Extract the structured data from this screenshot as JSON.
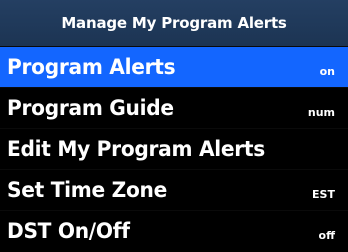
{
  "header": {
    "title": "Manage My Program Alerts"
  },
  "menu": {
    "items": [
      {
        "label": "Program Alerts",
        "value": "on",
        "selected": true
      },
      {
        "label": "Program Guide",
        "value": "num",
        "selected": false
      },
      {
        "label": "Edit My Program Alerts",
        "value": "",
        "selected": false
      },
      {
        "label": "Set Time Zone",
        "value": "EST",
        "selected": false
      },
      {
        "label": "DST On/Off",
        "value": "off",
        "selected": false
      }
    ]
  },
  "colors": {
    "header_bg": "#20385A",
    "selected_bg": "#1366FF",
    "screen_bg": "#000000",
    "text": "#FFFFFF"
  }
}
